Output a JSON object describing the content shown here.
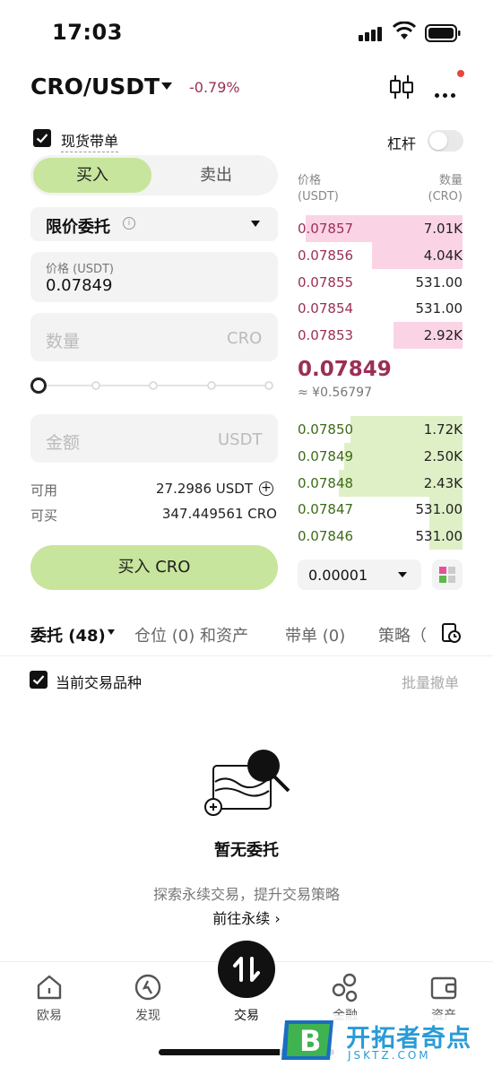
{
  "status_bar": {
    "time": "17:03"
  },
  "header": {
    "pair": "CRO/USDT",
    "change": "-0.79%"
  },
  "spot": {
    "label": "现货带单",
    "leverage_label": "杠杆"
  },
  "trade_tabs": {
    "buy": "买入",
    "sell": "卖出"
  },
  "order_type": {
    "label": "限价委托",
    "info_icon": "i"
  },
  "price_field": {
    "caption": "价格 (USDT)",
    "value": "0.07849"
  },
  "qty_field": {
    "placeholder": "数量",
    "unit": "CRO"
  },
  "amount_field": {
    "placeholder": "金额",
    "unit": "USDT"
  },
  "slider": {
    "value_percent": 0
  },
  "available": {
    "label": "可用",
    "value": "27.2986 USDT",
    "plus": "+"
  },
  "buyable": {
    "label": "可买",
    "value": "347.449561 CRO"
  },
  "buy_button": "买入 CRO",
  "orderbook": {
    "price_header": "价格",
    "price_unit": "(USDT)",
    "qty_header": "数量",
    "qty_unit": "(CRO)",
    "asks": [
      {
        "price": "0.07857",
        "qty": "7.01K",
        "depth": 0.95
      },
      {
        "price": "0.07856",
        "qty": "4.04K",
        "depth": 0.55
      },
      {
        "price": "0.07855",
        "qty": "531.00",
        "depth": 0.0
      },
      {
        "price": "0.07854",
        "qty": "531.00",
        "depth": 0.0
      },
      {
        "price": "0.07853",
        "qty": "2.92K",
        "depth": 0.42
      }
    ],
    "last_price": "0.07849",
    "last_cny": "≈ ¥0.56797",
    "bids": [
      {
        "price": "0.07850",
        "qty": "1.72K",
        "depth": 0.68
      },
      {
        "price": "0.07849",
        "qty": "2.50K",
        "depth": 0.72
      },
      {
        "price": "0.07848",
        "qty": "2.43K",
        "depth": 0.75
      },
      {
        "price": "0.07847",
        "qty": "531.00",
        "depth": 0.2
      },
      {
        "price": "0.07846",
        "qty": "531.00",
        "depth": 0.2
      }
    ],
    "precision": "0.00001"
  },
  "order_tabs": [
    {
      "label": "委托 (48)"
    },
    {
      "label": "仓位 (0) 和资产"
    },
    {
      "label": "带单 (0)"
    },
    {
      "label": "策略（"
    }
  ],
  "filter": {
    "current_label": "当前交易品种",
    "cancel_all": "批量撤单"
  },
  "empty": {
    "title": "暂无委托",
    "subtitle": "探索永续交易，提升交易策略",
    "link": "前往永续 ›"
  },
  "nav": {
    "items": [
      {
        "label": "欧易",
        "icon": "home-icon"
      },
      {
        "label": "发现",
        "icon": "discover-icon"
      },
      {
        "label": "交易",
        "icon": "trade-icon"
      },
      {
        "label": "金融",
        "icon": "finance-icon"
      },
      {
        "label": "资产",
        "icon": "wallet-icon"
      }
    ]
  },
  "watermark": {
    "logo_letter": "B",
    "text": "开拓者奇点",
    "url": "JSKTZ.COM"
  },
  "colors": {
    "accent_green": "#c7e59c",
    "ask_red": "#9b2f57",
    "bid_green": "#3d6b17"
  }
}
